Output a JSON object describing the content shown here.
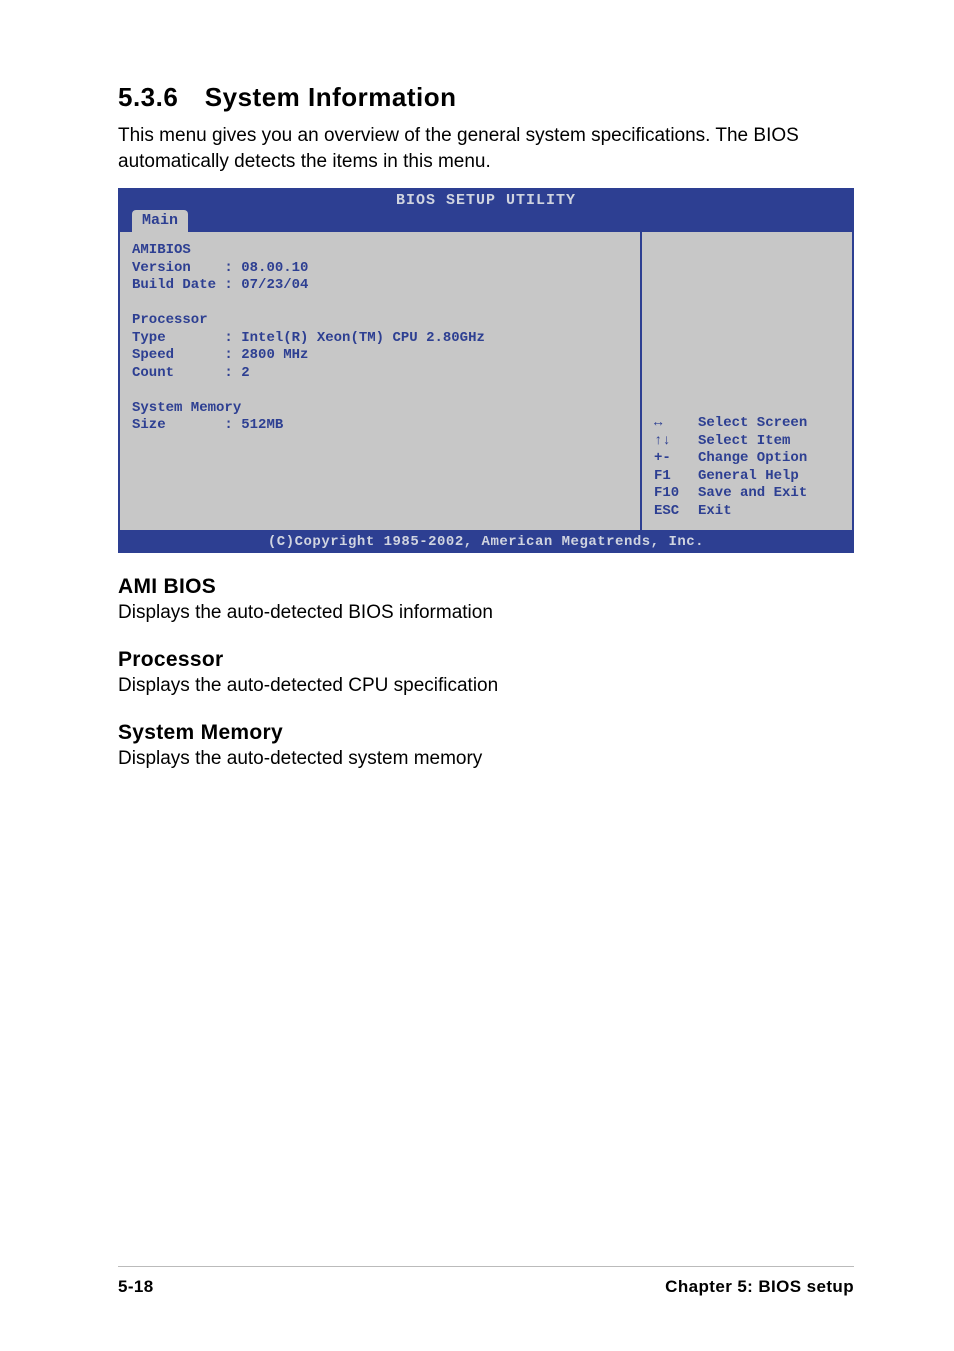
{
  "section": {
    "num": "5.3.6",
    "title": "System Information"
  },
  "intro": "This menu gives you an overview of the general system specifications. The BIOS automatically detects the items in this menu.",
  "bios": {
    "header": "BIOS SETUP UTILITY",
    "tab": "Main",
    "amibios_label": "AMIBIOS",
    "version_label": "Version",
    "version_value": "08.00.10",
    "build_label": "Build Date",
    "build_value": "07/23/04",
    "proc_label": "Processor",
    "type_label": "Type",
    "type_value": "Intel(R) Xeon(TM) CPU 2.80GHz",
    "speed_label": "Speed",
    "speed_value": "2800 MHz",
    "count_label": "Count",
    "count_value": "2",
    "mem_label": "System Memory",
    "size_label": "Size",
    "size_value": "512MB",
    "help": {
      "k1": "",
      "t1": "Select Screen",
      "k2": "",
      "t2": "Select Item",
      "k3": "+-",
      "t3": "Change Option",
      "k4": "F1",
      "t4": "General Help",
      "k5": "F10",
      "t5": "Save and Exit",
      "k6": "ESC",
      "t6": "Exit"
    },
    "footer": "(C)Copyright 1985-2002, American Megatrends, Inc."
  },
  "subs": {
    "ami_h": "AMI BIOS",
    "ami_t": "Displays the auto-detected BIOS information",
    "proc_h": "Processor",
    "proc_t": "Displays the auto-detected CPU specification",
    "mem_h": "System Memory",
    "mem_t": "Displays the auto-detected system memory"
  },
  "footer": {
    "left": "5-18",
    "right": "Chapter 5: BIOS setup"
  }
}
